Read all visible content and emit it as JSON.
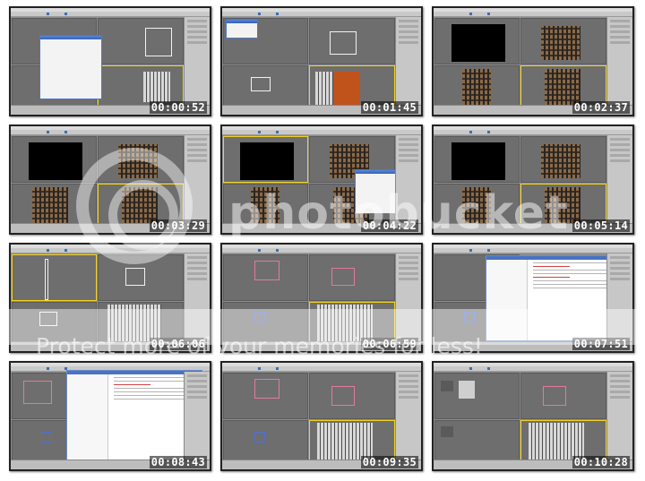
{
  "thumbnails": [
    {
      "timecode": "00:00:52"
    },
    {
      "timecode": "00:01:45"
    },
    {
      "timecode": "00:02:37"
    },
    {
      "timecode": "00:03:29"
    },
    {
      "timecode": "00:04:22"
    },
    {
      "timecode": "00:05:14"
    },
    {
      "timecode": "00:06:06"
    },
    {
      "timecode": "00:06:59"
    },
    {
      "timecode": "00:07:51"
    },
    {
      "timecode": "00:08:43"
    },
    {
      "timecode": "00:09:35"
    },
    {
      "timecode": "00:10:28"
    }
  ],
  "watermark": {
    "brand": "photobucket",
    "tagline": "Protect more of your memories for less!"
  },
  "colors": {
    "viewport_bg": "#6e6e6e",
    "active_viewport_border": "#f4d21c",
    "timecode_text": "#ffffff"
  }
}
